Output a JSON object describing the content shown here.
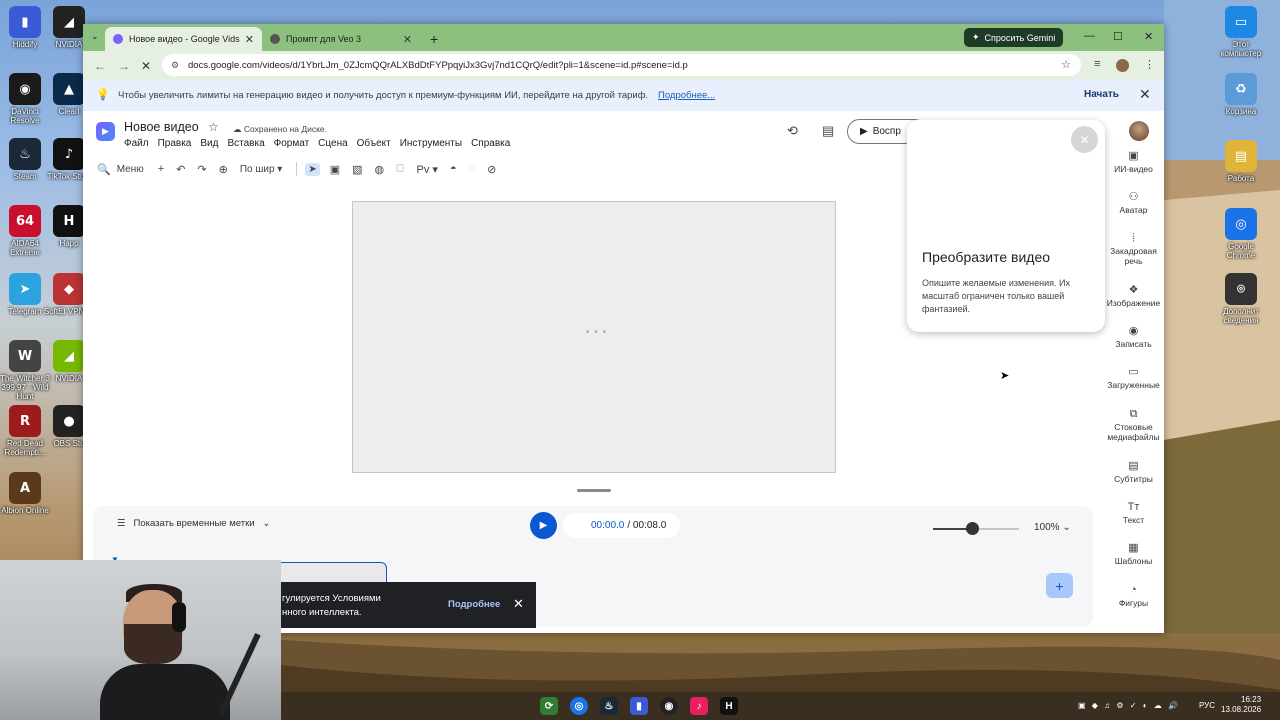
{
  "desktop": {
    "left_icons": [
      {
        "label": "Hiddify",
        "glyph": "▮",
        "color": "#3b5bd6"
      },
      {
        "label": "NVIDIA",
        "glyph": "◢",
        "color": "#222"
      },
      {
        "label": "DaVinci Resolve",
        "glyph": "◉",
        "color": "#1a1a1a"
      },
      {
        "label": "Clearl",
        "glyph": "▲",
        "color": "#0a2a4a"
      },
      {
        "label": "Steam",
        "glyph": "♨",
        "color": "#1b2838"
      },
      {
        "label": "TikTok Studi",
        "glyph": "♪",
        "color": "#111"
      },
      {
        "label": "AIDA64 Extreme",
        "glyph": "64",
        "color": "#c8102e"
      },
      {
        "label": "Happ",
        "glyph": "H",
        "color": "#111"
      },
      {
        "label": "Telegram",
        "glyph": "➤",
        "color": "#2aa3df"
      },
      {
        "label": "SoftEt VPN Cl",
        "glyph": "◆",
        "color": "#b33"
      },
      {
        "label": "The Witcher 3 399.97 - Wild Hunt",
        "glyph": "W",
        "color": "#444"
      },
      {
        "label": "NVIDIA",
        "glyph": "◢",
        "color": "#76b900"
      },
      {
        "label": "Red Dead Redempti...",
        "glyph": "R",
        "color": "#9e1b1b"
      },
      {
        "label": "OBS Stu",
        "glyph": "●",
        "color": "#222"
      },
      {
        "label": "Albion Online",
        "glyph": "A",
        "color": "#5a3a1a"
      }
    ],
    "right_icons": [
      {
        "label": "Этот компьютер",
        "glyph": "▭",
        "color": "#1e88e5"
      },
      {
        "label": "Корзина",
        "glyph": "♻",
        "color": "#5a9bd8"
      },
      {
        "label": "Работа",
        "glyph": "▤",
        "color": "#e0b33a"
      },
      {
        "label": "Google Chrome",
        "glyph": "◎",
        "color": "#1a73e8"
      },
      {
        "label": "Дополнит сведения",
        "glyph": "⌾",
        "color": "#333"
      }
    ]
  },
  "browser": {
    "tabs": [
      {
        "title": "Новое видео - Google Vids",
        "favicon_color": "#7b61ff"
      },
      {
        "title": "Промпт для Veo 3",
        "favicon_color": "#555"
      }
    ],
    "gemini_label": "Спросить Gemini",
    "url": "docs.google.com/videos/d/1YbrLJm_0ZJcmQQrALXBdDtFYPpqyiJx3Gvj7nd1CQrQ/edit?pli=1&scene=id.p#scene=id.p"
  },
  "infobar": {
    "message": "Чтобы увеличить лимиты на генерацию видео и получить доступ к премиум-функциям ИИ, перейдите на другой тариф.",
    "link": "Подробнее...",
    "action": "Начать"
  },
  "doc": {
    "title": "Новое видео",
    "saved": "Сохранено на Диске.",
    "menu": [
      "Файл",
      "Правка",
      "Вид",
      "Вставка",
      "Формат",
      "Сцена",
      "Объект",
      "Инструменты",
      "Справка"
    ],
    "play_label": "Воспр"
  },
  "toolbar": {
    "search_label": "Меню",
    "fit_label": "По шир"
  },
  "timeline": {
    "show_timestamps": "Показать временные метки",
    "current_time": "00:00.0",
    "total_time": "/ 00:08.0",
    "zoom_percent": "100%",
    "zoom_level": 0.45
  },
  "side_panel": [
    {
      "label": "ИИ-видео",
      "icon": "film-icon",
      "glyph": "▣"
    },
    {
      "label": "Аватар",
      "icon": "avatar-icon",
      "glyph": "⚇"
    },
    {
      "label": "Закадровая речь",
      "icon": "voiceover-icon",
      "glyph": "⦙"
    },
    {
      "label": "Изображение",
      "icon": "image-icon",
      "glyph": "❖"
    },
    {
      "label": "Записать",
      "icon": "record-icon",
      "glyph": "◉"
    },
    {
      "label": "Загруженные",
      "icon": "folder-icon",
      "glyph": "▭"
    },
    {
      "label": "Стоковые медиафайлы",
      "icon": "stock-media-icon",
      "glyph": "⧉"
    },
    {
      "label": "Субтитры",
      "icon": "subtitles-icon",
      "glyph": "▤"
    },
    {
      "label": "Текст",
      "icon": "text-icon",
      "glyph": "Tт"
    },
    {
      "label": "Шаблоны",
      "icon": "templates-icon",
      "glyph": "▦"
    },
    {
      "label": "Фигуры",
      "icon": "shapes-icon",
      "glyph": "◔"
    }
  ],
  "popup": {
    "title": "Преобразите видео",
    "description": "Опишите желаемые изменения. Их масштаб ограничен только вашей фантазией."
  },
  "toast": {
    "message_line1": "гулируется Условиями",
    "message_line2": "нного интеллекта.",
    "link": "Подробнее"
  },
  "taskbar": {
    "language": "РУС",
    "time": "16:23",
    "date": "13.08.2026"
  }
}
